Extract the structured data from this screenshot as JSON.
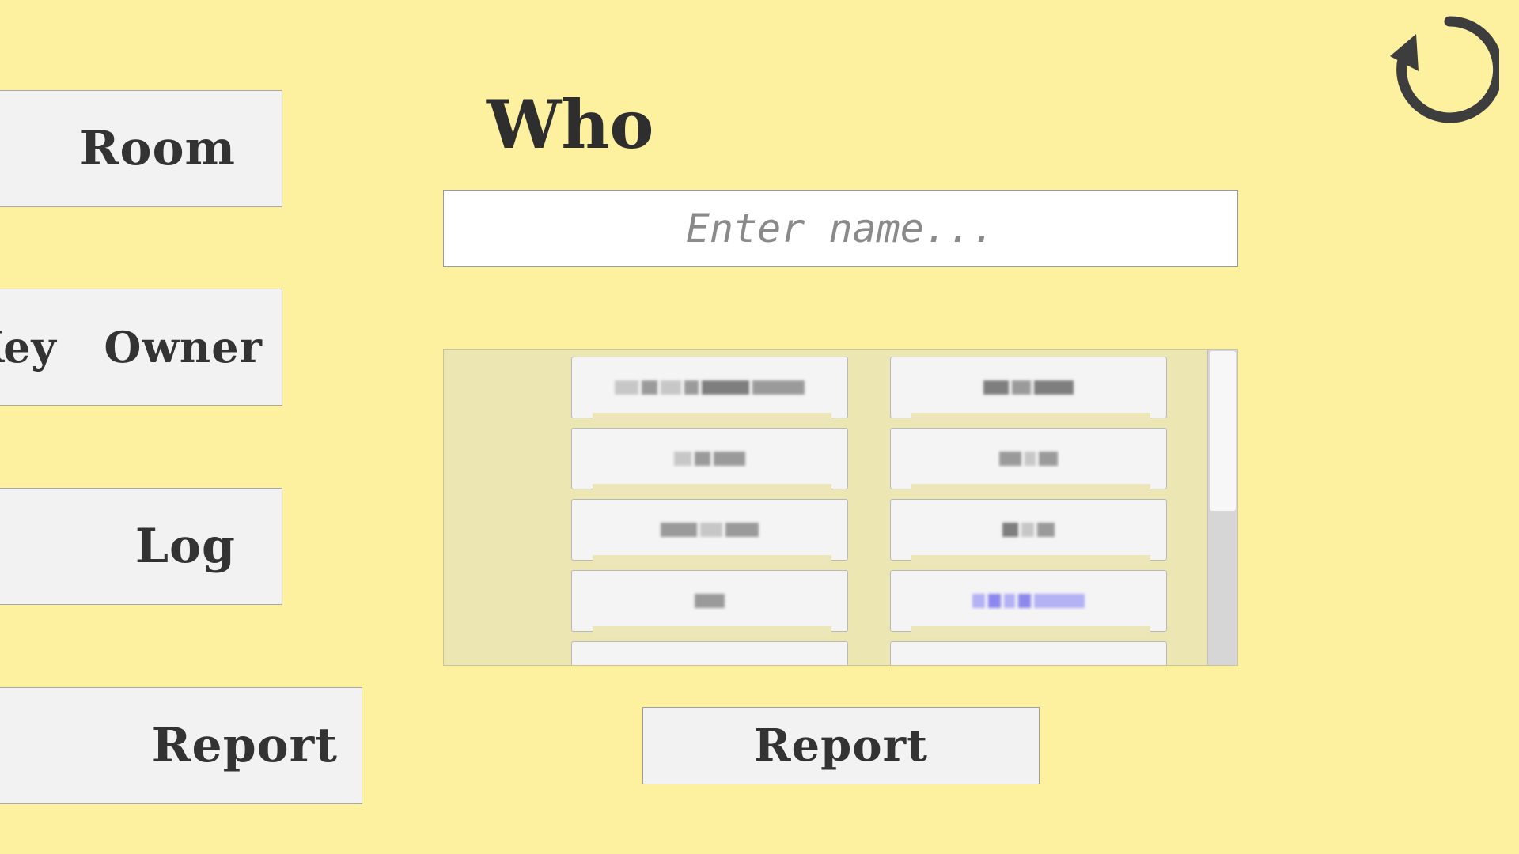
{
  "nav": {
    "room": "Room",
    "key_owner": "Key  Owner",
    "log": "Log",
    "report": "Report"
  },
  "refresh_icon": "refresh-icon",
  "main": {
    "title": "Who",
    "name_placeholder": "Enter name...",
    "name_value": "",
    "report_label": "Report"
  },
  "name_list": {
    "note": "",
    "items": [
      "",
      "",
      "",
      "",
      "",
      "",
      "",
      "",
      "",
      ""
    ]
  },
  "colors": {
    "background": "#fdf1a0",
    "button": "#f2f2f2",
    "text": "#333333",
    "list_background": "#ece6b2"
  }
}
